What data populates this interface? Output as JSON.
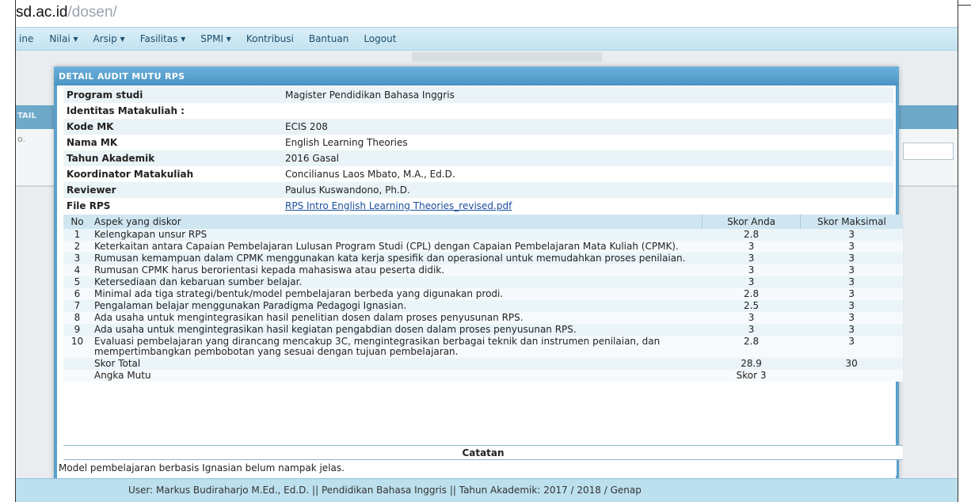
{
  "url": {
    "host": "sd.ac.id",
    "path": "/dosen/"
  },
  "nav": [
    "ine",
    "Nilai ▾",
    "Arsip ▾",
    "Fasilitas ▾",
    "SPMI ▾",
    "Kontribusi",
    "Bantuan",
    "Logout"
  ],
  "background": {
    "left_tab_text": "TAIL",
    "left_row_text": "o."
  },
  "dialog": {
    "title": "DETAIL AUDIT MUTU RPS",
    "info": [
      {
        "label": "Program studi",
        "value": "Magister Pendidikan Bahasa Inggris"
      },
      {
        "label": "Identitas Matakuliah :",
        "value": ""
      },
      {
        "label": "Kode MK",
        "value": "ECIS 208"
      },
      {
        "label": "Nama MK",
        "value": "English Learning Theories"
      },
      {
        "label": "Tahun Akademik",
        "value": "2016 Gasal"
      },
      {
        "label": "Koordinator Matakuliah",
        "value": "Concilianus Laos Mbato, M.A., Ed.D."
      },
      {
        "label": "Reviewer",
        "value": "Paulus Kuswandono, Ph.D."
      },
      {
        "label": "File RPS",
        "value": "RPS Intro English Learning Theories_revised.pdf"
      }
    ],
    "table": {
      "headers": {
        "no": "No",
        "aspek": "Aspek yang diskor",
        "skor": "Skor Anda",
        "maks": "Skor Maksimal"
      },
      "rows": [
        {
          "no": "1",
          "aspek": "Kelengkapan unsur RPS",
          "skor": "2.8",
          "maks": "3"
        },
        {
          "no": "2",
          "aspek": "Keterkaitan antara Capaian Pembelajaran Lulusan Program Studi (CPL) dengan Capaian Pembelajaran Mata Kuliah (CPMK).",
          "skor": "3",
          "maks": "3"
        },
        {
          "no": "3",
          "aspek": "Rumusan kemampuan dalam CPMK menggunakan kata kerja spesifik dan operasional untuk memudahkan proses penilaian.",
          "skor": "3",
          "maks": "3"
        },
        {
          "no": "4",
          "aspek": "Rumusan CPMK harus berorientasi kepada mahasiswa atau peserta didik.",
          "skor": "3",
          "maks": "3"
        },
        {
          "no": "5",
          "aspek": "Ketersediaan dan kebaruan sumber belajar.",
          "skor": "3",
          "maks": "3"
        },
        {
          "no": "6",
          "aspek": "Minimal ada tiga strategi/bentuk/model pembelajaran berbeda yang digunakan prodi.",
          "skor": "2.8",
          "maks": "3"
        },
        {
          "no": "7",
          "aspek": "Pengalaman belajar menggunakan Paradigma Pedagogi Ignasian.",
          "skor": "2.5",
          "maks": "3"
        },
        {
          "no": "8",
          "aspek": "Ada usaha untuk mengintegrasikan hasil penelitian dosen dalam proses penyusunan RPS.",
          "skor": "3",
          "maks": "3"
        },
        {
          "no": "9",
          "aspek": "Ada usaha untuk mengintegrasikan hasil kegiatan pengabdian dosen dalam proses penyusunan RPS.",
          "skor": "3",
          "maks": "3"
        },
        {
          "no": "10",
          "aspek": "Evaluasi pembelajaran yang dirancang mencakup 3C, mengintegrasikan berbagai teknik dan instrumen penilaian, dan mempertimbangkan pembobotan yang sesuai dengan tujuan pembelajaran.",
          "skor": "2.8",
          "maks": "3"
        }
      ],
      "total": {
        "label": "Skor Total",
        "skor": "28.9",
        "maks": "30"
      },
      "mutu": {
        "label": "Angka Mutu",
        "skor": "Skor 3"
      }
    },
    "catatan": {
      "title": "Catatan",
      "text": "Model pembelajaran berbasis Ignasian belum nampak jelas."
    }
  },
  "footer": "User: Markus Budiraharjo M.Ed., Ed.D. || Pendidikan Bahasa Inggris || Tahun Akademik: 2017 / 2018 / Genap"
}
